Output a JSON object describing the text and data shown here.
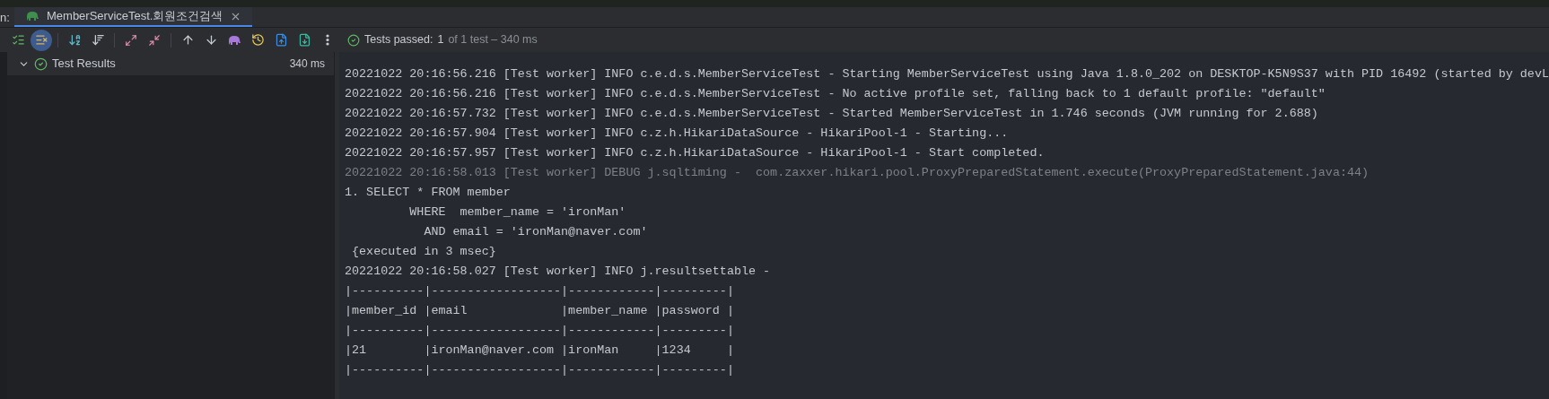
{
  "run_label": "n:",
  "tab": {
    "label": "MemberServiceTest.회원조건검색",
    "selected": true
  },
  "toolbar_toggles": [
    {
      "selected": false
    },
    {
      "selected": true
    }
  ],
  "status": {
    "prefix": "Tests passed:",
    "passed": "1",
    "rest": "of 1 test – 340 ms"
  },
  "tree": [
    {
      "label": "Test Results",
      "duration": "340 ms",
      "expanded": true,
      "passed": true
    }
  ],
  "console": [
    {
      "kind": "info",
      "text": "20221022 20:16:56.216 [Test worker] INFO c.e.d.s.MemberServiceTest - Starting MemberServiceTest using Java 1.8.0_202 on DESKTOP-K5N9S37 with PID 16492 (started by devL"
    },
    {
      "kind": "info",
      "text": "20221022 20:16:56.216 [Test worker] INFO c.e.d.s.MemberServiceTest - No active profile set, falling back to 1 default profile: \"default\""
    },
    {
      "kind": "info",
      "text": "20221022 20:16:57.732 [Test worker] INFO c.e.d.s.MemberServiceTest - Started MemberServiceTest in 1.746 seconds (JVM running for 2.688)"
    },
    {
      "kind": "info",
      "text": "20221022 20:16:57.904 [Test worker] INFO c.z.h.HikariDataSource - HikariPool-1 - Starting..."
    },
    {
      "kind": "info",
      "text": "20221022 20:16:57.957 [Test worker] INFO c.z.h.HikariDataSource - HikariPool-1 - Start completed."
    },
    {
      "kind": "debug",
      "text": "20221022 20:16:58.013 [Test worker] DEBUG j.sqltiming -  com.zaxxer.hikari.pool.ProxyPreparedStatement.execute(ProxyPreparedStatement.java:44)"
    },
    {
      "kind": "info",
      "text": "1. SELECT * FROM member"
    },
    {
      "kind": "info",
      "text": "         WHERE  member_name = 'ironMan'"
    },
    {
      "kind": "info",
      "text": "           AND email = 'ironMan@naver.com'"
    },
    {
      "kind": "info",
      "text": " {executed in 3 msec}"
    },
    {
      "kind": "info",
      "text": "20221022 20:16:58.027 [Test worker] INFO j.resultsettable -"
    },
    {
      "kind": "info",
      "text": "|----------|------------------|------------|---------|"
    },
    {
      "kind": "info",
      "text": "|member_id |email             |member_name |password |"
    },
    {
      "kind": "info",
      "text": "|----------|------------------|------------|---------|"
    },
    {
      "kind": "info",
      "text": "|21        |ironMan@naver.com |ironMan     |1234     |"
    },
    {
      "kind": "info",
      "text": "|----------|------------------|------------|---------|"
    }
  ]
}
